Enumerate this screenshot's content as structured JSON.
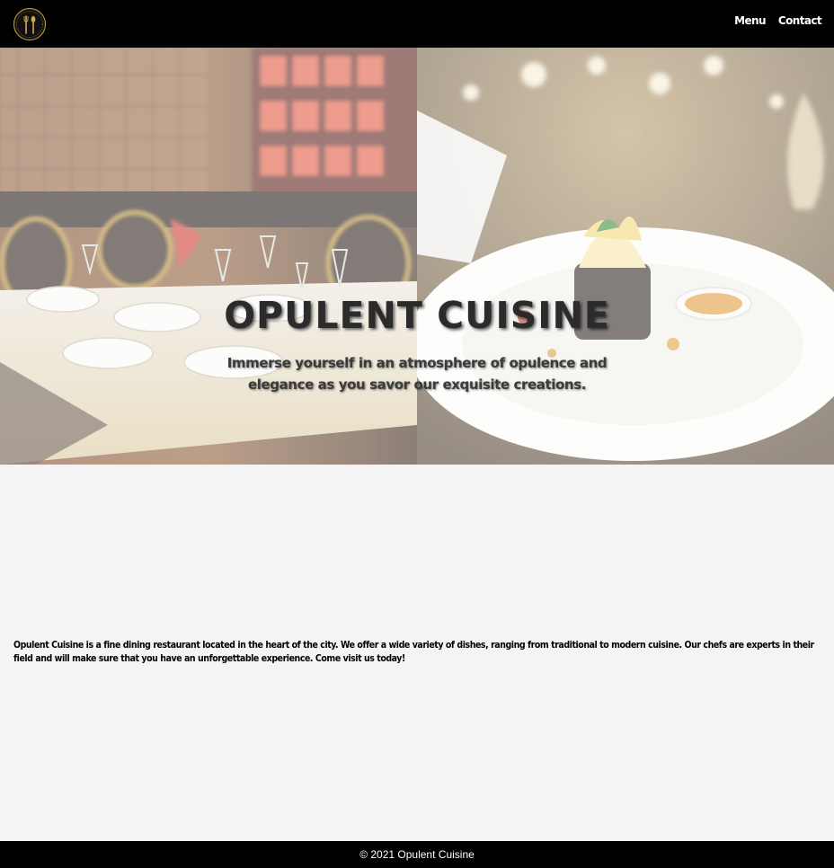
{
  "header": {
    "logo_icon": "fork-spoon-logo-icon",
    "nav": [
      {
        "label": "Menu"
      },
      {
        "label": "Contact"
      }
    ]
  },
  "hero": {
    "title": "OPULENT CUISINE",
    "subtitle": "Immerse yourself in an atmosphere of opulence and elegance as you savor our exquisite creations."
  },
  "about": {
    "text": "Opulent Cuisine is a fine dining restaurant located in the heart of the city. We offer a wide variety of dishes, ranging from traditional to modern cuisine. Our chefs are experts in their field and will make sure that you have an unforgettable experience. Come visit us today!"
  },
  "footer": {
    "copyright": "© 2021 Opulent Cuisine"
  },
  "colors": {
    "bar": "#000000",
    "page_bg": "#f4f4f4",
    "logo_gold": "#b8923a"
  }
}
